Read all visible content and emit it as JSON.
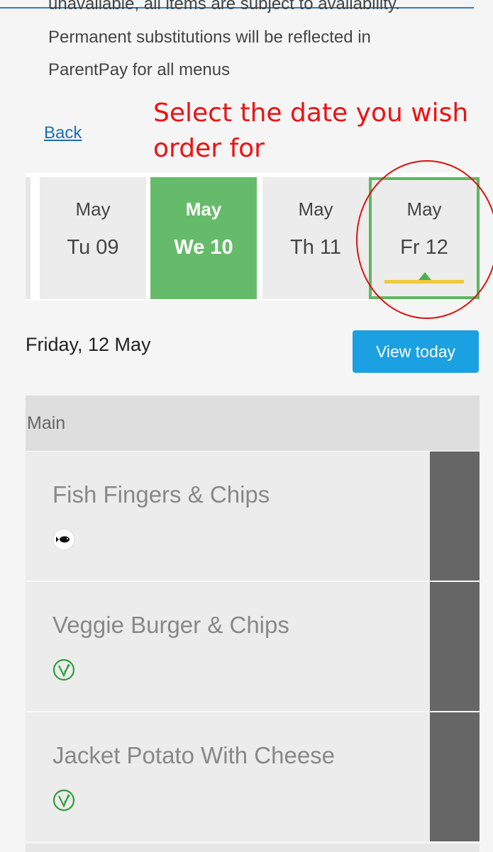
{
  "notice": {
    "line1": "unavailable, all items are subject to availability.",
    "line2": "Permanent substitutions will be reflected in",
    "line3": "ParentPay for all menus"
  },
  "back_label": "Back",
  "annotation": "Select the date you wish order for",
  "dates": [
    {
      "month": "May",
      "day": "Tu 09"
    },
    {
      "month": "May",
      "day": "We 10"
    },
    {
      "month": "May",
      "day": "Th 11"
    },
    {
      "month": "May",
      "day": "Fr 12"
    }
  ],
  "day_heading": "Friday, 12 May",
  "view_today_label": "View today",
  "section": "Main",
  "items": [
    {
      "name": "Fish Fingers & Chips",
      "icon": "fish-icon"
    },
    {
      "name": "Veggie Burger & Chips",
      "icon": "vegetarian-icon"
    },
    {
      "name": "Jacket Potato With Cheese",
      "icon": "vegetarian-icon"
    }
  ],
  "colors": {
    "selected_date": "#66bb6a",
    "today_marker": "#f0c93a",
    "button": "#1ba0e1",
    "annotation": "#ee1111"
  }
}
